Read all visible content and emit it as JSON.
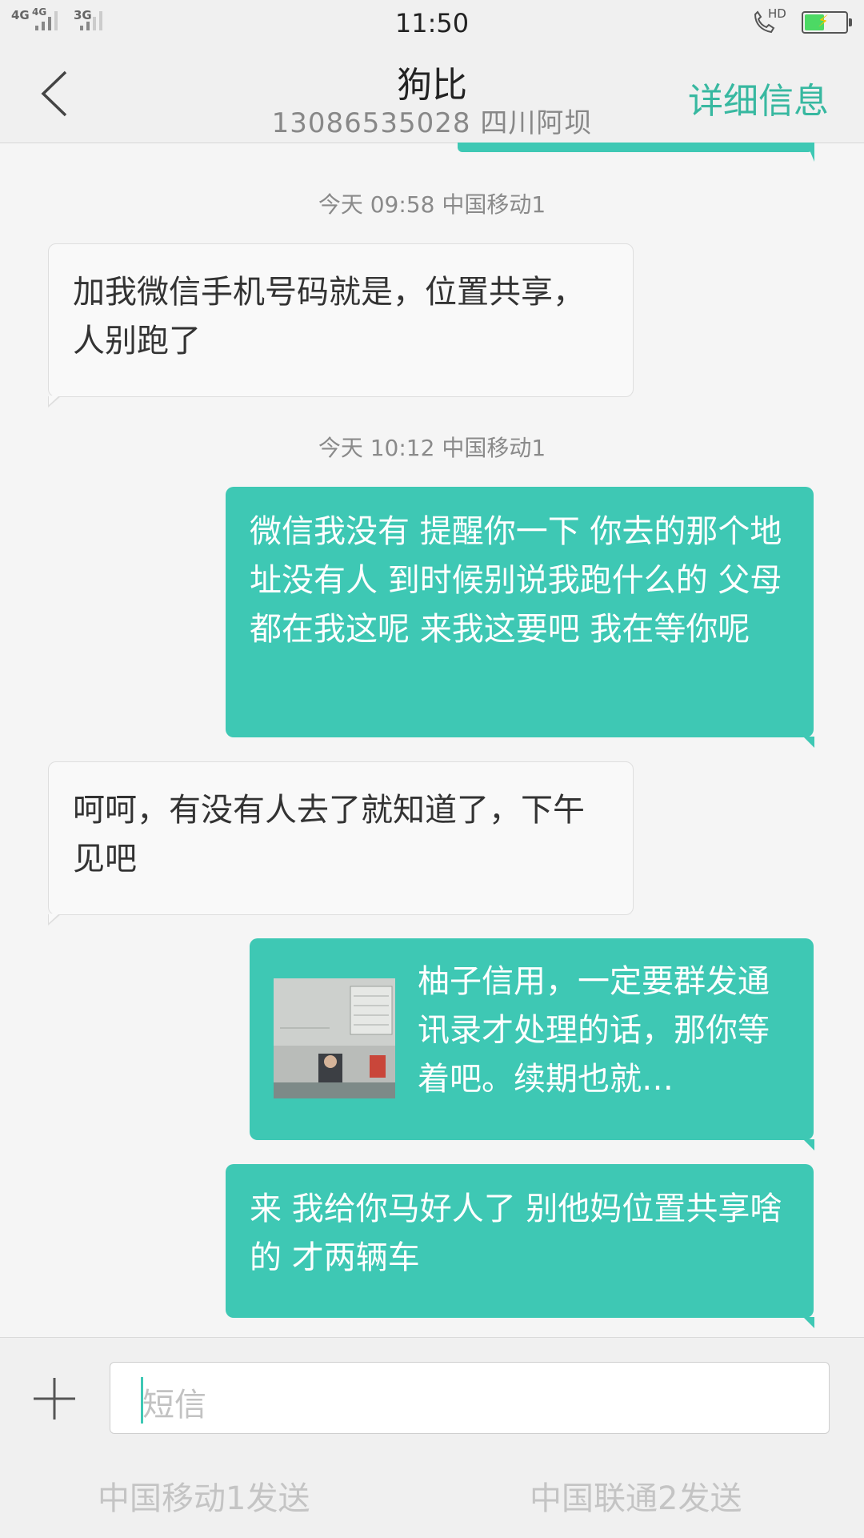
{
  "status_bar": {
    "sim1_network": "4G",
    "sim1_network_secondary": "4G",
    "sim2_network": "3G",
    "time": "11:50",
    "call_badge": "HD",
    "battery_level": 0.45,
    "battery_charging": true
  },
  "header": {
    "contact_name": "狗比",
    "contact_subtitle": "13086535028  四川阿坝",
    "detail_label": "详细信息"
  },
  "messages": {
    "stamp1": "今天  09:58  中国移动1",
    "msg1": "加我微信手机号码就是，位置共享，人别跑了",
    "stamp2": "今天  10:12  中国移动1",
    "msg2": "微信我没有  提醒你一下 你去的那个地址没有人 到时候别说我跑什么的 父母都在我这呢 来我这要吧 我在等你呢",
    "msg3": "呵呵，有没有人去了就知道了，下午见吧",
    "msg4": "柚子信用，一定要群发通讯录才处理的话，那你等着吧。续期也就…",
    "msg5": "来 我给你马好人了 别他妈位置共享啥的 才两辆车"
  },
  "composer": {
    "placeholder": "短信",
    "send_sim1": "中国移动1发送",
    "send_sim2": "中国联通2发送"
  },
  "colors": {
    "accent": "#3ec8b4",
    "header_bg": "#f0f0f0",
    "page_bg": "#f5f5f5"
  }
}
